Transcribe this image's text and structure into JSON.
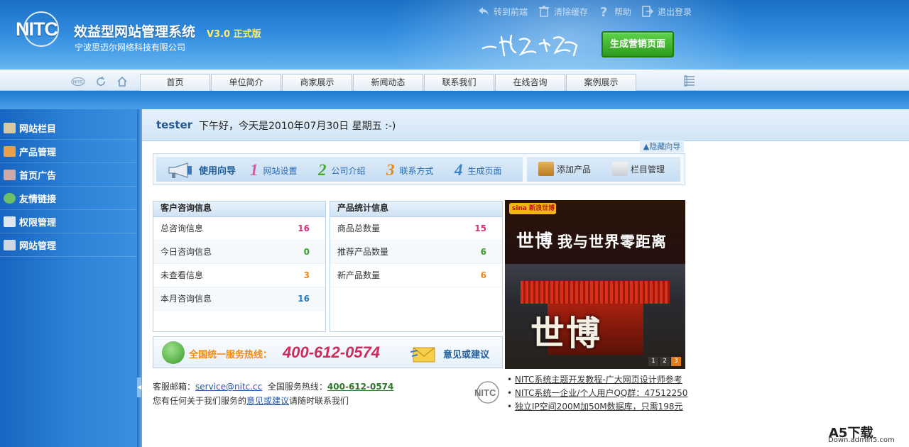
{
  "header": {
    "logo_text": "NITC",
    "title": "效益型网站管理系统",
    "version": "V3.0 正式版",
    "company": "宁波思迈尔网络科技有限公司",
    "slogan": "一切为了效益",
    "generate_button": "生成营销页面",
    "toplinks": [
      {
        "label": "转到前端",
        "icon": "back-arrow-icon"
      },
      {
        "label": "清除缓存",
        "icon": "trash-icon"
      },
      {
        "label": "帮助",
        "icon": "help-icon"
      },
      {
        "label": "退出登录",
        "icon": "logout-icon"
      }
    ]
  },
  "nav": {
    "tabs": [
      "首页",
      "单位简介",
      "商家展示",
      "新闻动态",
      "联系我们",
      "在线咨询",
      "案例展示"
    ],
    "left_icons": [
      "nitc-icon",
      "refresh-icon",
      "home-icon"
    ],
    "right_icon": "list-menu-icon"
  },
  "sidebar": {
    "items": [
      {
        "label": "网站栏目",
        "icon": "folder-icon",
        "color": "#d9c9a0"
      },
      {
        "label": "产品管理",
        "icon": "product-icon",
        "color": "#e8a04a"
      },
      {
        "label": "首页广告",
        "icon": "ad-icon",
        "color": "#cfa8a8"
      },
      {
        "label": "友情链接",
        "icon": "globe-link-icon",
        "color": "#6cc06a"
      },
      {
        "label": "权限管理",
        "icon": "id-card-icon",
        "color": "#dfe6ee"
      },
      {
        "label": "网站管理",
        "icon": "settings-icon",
        "color": "#cfd8e2"
      }
    ]
  },
  "welcome": {
    "user": "tester",
    "greeting": "下午好，今天是2010年07月30日 星期五 :-)"
  },
  "guide": {
    "hide_label": "隐藏向导",
    "title": "使用向导",
    "steps": [
      {
        "num": "1",
        "label": "网站设置",
        "color": "#d35aa0"
      },
      {
        "num": "2",
        "label": "公司介绍",
        "color": "#49a832"
      },
      {
        "num": "3",
        "label": "联系方式",
        "color": "#e58a1a"
      },
      {
        "num": "4",
        "label": "生成页面",
        "color": "#3a80d0"
      }
    ],
    "actions": [
      {
        "label": "添加产品",
        "icon": "add-product-icon"
      },
      {
        "label": "栏目管理",
        "icon": "column-manage-icon"
      }
    ]
  },
  "consult": {
    "title": "客户咨询信息",
    "rows": [
      {
        "label": "总咨询信息",
        "value": "16",
        "color": "#d3337a"
      },
      {
        "label": "今日咨询信息",
        "value": "0",
        "color": "#38a02a"
      },
      {
        "label": "未查看信息",
        "value": "3",
        "color": "#e58a1a"
      },
      {
        "label": "本月咨询信息",
        "value": "16",
        "color": "#2a7ac0"
      }
    ]
  },
  "product_stats": {
    "title": "产品统计信息",
    "rows": [
      {
        "label": "商品总数量",
        "value": "15",
        "color": "#d3337a"
      },
      {
        "label": "推荐产品数量",
        "value": "6",
        "color": "#38a02a"
      },
      {
        "label": "新产品数量",
        "value": "6",
        "color": "#e58a1a"
      }
    ]
  },
  "hotline": {
    "label": "全国统一服务热线：",
    "number": "400-612-0574",
    "feedback": "意见或建议"
  },
  "contact": {
    "email_label": "客服邮箱：",
    "email": "service@nitc.cc",
    "hotline_label": "全国服务热线：",
    "hotline": "400-612-0574",
    "line2_pre": "您有任何关于我们服务的",
    "line2_link": "意见或建议",
    "line2_post": "请随时联系我们"
  },
  "banner": {
    "brand": "sina 新浪世博",
    "title_big": "世博",
    "title_rest": "我与世界零距离",
    "calligraphy": "世博",
    "pages": [
      "1",
      "2",
      "3"
    ],
    "active_page": 3
  },
  "news": [
    "NITC系统主题开发教程-广大网页设计师参考",
    "NITC系统一企业/个人用户QQ群：47512250",
    "独立IP空间200M加50M数据库，只需198元"
  ],
  "watermark": {
    "text": "A5下载",
    "url": "Down.admin5.com"
  }
}
